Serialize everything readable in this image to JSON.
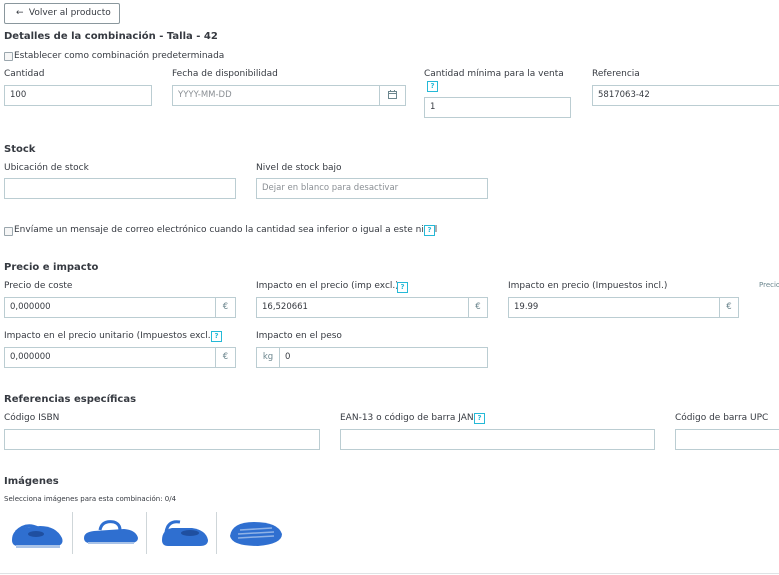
{
  "back_button": {
    "label": "Volver al producto",
    "icon": "arrow-left-icon"
  },
  "title": "Detalles de la combinación - Talla - 42",
  "default_checkbox_label": "Establecer como combinación predeterminada",
  "quantity": {
    "label": "Cantidad",
    "value": "100"
  },
  "availability": {
    "label": "Fecha de disponibilidad",
    "placeholder": "YYYY-MM-DD",
    "icon": "calendar-icon"
  },
  "min_quantity": {
    "label": "Cantidad mínima para la venta",
    "value": "1",
    "help": "?"
  },
  "reference": {
    "label": "Referencia",
    "value": "5817063-42"
  },
  "stock": {
    "heading": "Stock",
    "location_label": "Ubicación de stock",
    "location_value": "",
    "low_label": "Nivel de stock bajo",
    "low_placeholder": "Dejar en blanco para desactivar",
    "email_checkbox_label": "Envíame un mensaje de correo electrónico cuando la cantidad sea inferior o igual a este nivel",
    "help": "?"
  },
  "price": {
    "heading": "Precio e impacto",
    "cost_label": "Precio de coste",
    "cost_value": "0,000000",
    "impact_excl_label": "Impacto en el precio (imp excl.)",
    "impact_excl_value": "16,520661",
    "impact_incl_label": "Impacto en precio (Impuestos incl.)",
    "impact_incl_value": "19.99",
    "final_label_partial": "Precio",
    "unit_label": "Impacto en el precio unitario (Impuestos excl.)",
    "unit_value": "0,000000",
    "weight_label": "Impacto en el peso",
    "weight_unit": "kg",
    "weight_value": "0",
    "currency": "€",
    "help": "?"
  },
  "refs": {
    "heading": "Referencias específicas",
    "isbn_label": "Código ISBN",
    "ean_label": "EAN-13 o código de barra JAN",
    "upc_label": "Código de barra UPC",
    "help": "?"
  },
  "images": {
    "heading": "Imágenes",
    "hint": "Selecciona imágenes para esta combinación: 0/4",
    "count": 4,
    "color": "#2f6fd0"
  }
}
